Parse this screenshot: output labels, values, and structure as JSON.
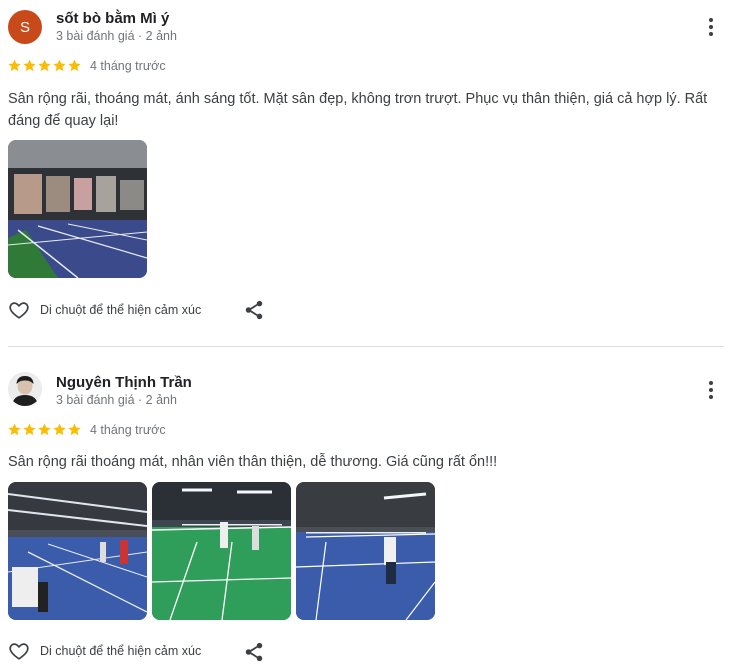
{
  "reviews": [
    {
      "avatar_letter": "S",
      "avatar_color": "#c84a1b",
      "name": "sốt bò bằm Mì ý",
      "meta": "3 bài đánh giá · 2 ảnh",
      "rating": 5,
      "time": "4 tháng trước",
      "text": "Sân rộng rãi, thoáng mát, ánh sáng tốt. Mặt sân đẹp, không trơn trượt. Phục vụ thân thiện, giá cả hợp lý. Rất đáng để quay lại!",
      "react_label": "Di chuột để thể hiện cảm xúc",
      "photo_count": 1
    },
    {
      "avatar_letter": "",
      "name": "Nguyên Thịnh Trần",
      "meta": "3 bài đánh giá · 2 ảnh",
      "rating": 5,
      "time": "4 tháng trước",
      "text": "Sân rộng rãi thoáng mát, nhân viên thân thiện, dễ thương. Giá cũng rất ổn!!!",
      "react_label": "Di chuột để thể hiện cảm xúc",
      "photo_count": 3
    }
  ],
  "icons": {
    "more": "more-vert-icon",
    "star": "star-icon",
    "heart": "heart-outline-icon",
    "share": "share-icon"
  },
  "colors": {
    "star": "#fbbc04",
    "court_blue": "#3a5cab",
    "court_green": "#2e9e5a"
  }
}
